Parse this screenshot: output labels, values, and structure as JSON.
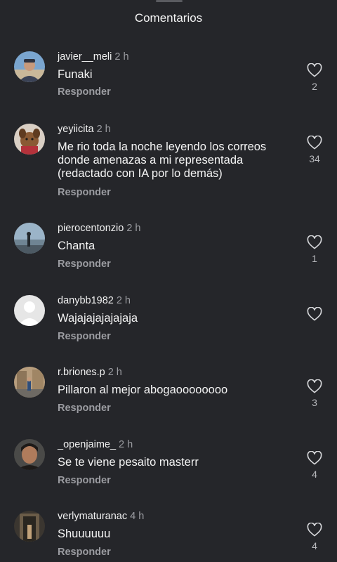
{
  "header": {
    "title": "Comentarios"
  },
  "reply_label": "Responder",
  "colors": {
    "background": "#25262a",
    "muted_text": "#9b9ca1",
    "primary_text": "#f1f1f1"
  },
  "comments": [
    {
      "username": "javier__meli",
      "time": "2 h",
      "text": "Funaki",
      "likes": "2",
      "avatar": "man-beach-avatar"
    },
    {
      "username": "yeyiicita",
      "time": "2 h",
      "text": "Me rio toda la noche leyendo los correos donde amenazas a mi representada (redactado con IA por lo demás)",
      "likes": "34",
      "avatar": "dog-avatar"
    },
    {
      "username": "pierocentonzio",
      "time": "2 h",
      "text": "Chanta",
      "likes": "1",
      "avatar": "beach-walk-avatar"
    },
    {
      "username": "danybb1982",
      "time": "2 h",
      "text": "Wajajajajajajaja",
      "likes": "",
      "avatar": "default-avatar"
    },
    {
      "username": "r.briones.p",
      "time": "2 h",
      "text": "Pillaron al mejor abogaoooooooo",
      "likes": "3",
      "avatar": "street-avatar"
    },
    {
      "username": "_openjaime_",
      "time": "2 h",
      "text": "Se te viene pesaito masterr",
      "likes": "4",
      "avatar": "portrait-avatar"
    },
    {
      "username": "verlymaturanac",
      "time": "4 h",
      "text": "Shuuuuuu",
      "likes": "4",
      "avatar": "doorway-avatar"
    }
  ]
}
